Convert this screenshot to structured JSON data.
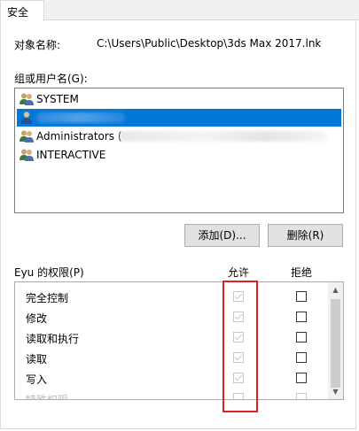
{
  "tabs": [
    {
      "label": "安全"
    }
  ],
  "object_name": {
    "label": "对象名称:",
    "value": "C:\\Users\\Public\\Desktop\\3ds Max 2017.lnk"
  },
  "groups": {
    "label": "组或用户名(G):",
    "items": [
      {
        "name": "SYSTEM",
        "selected": false
      },
      {
        "name": "",
        "selected": true
      },
      {
        "name": "Administrators (",
        "selected": false
      },
      {
        "name": "INTERACTIVE",
        "selected": false
      }
    ]
  },
  "buttons": {
    "add": "添加(D)...",
    "remove": "删除(R)"
  },
  "permissions": {
    "label": "Eyu 的权限(P)",
    "allow_header": "允许",
    "deny_header": "拒绝",
    "rows": [
      {
        "name": "完全控制",
        "allow": true,
        "deny": false
      },
      {
        "name": "修改",
        "allow": true,
        "deny": false
      },
      {
        "name": "读取和执行",
        "allow": true,
        "deny": false
      },
      {
        "name": "读取",
        "allow": true,
        "deny": false
      },
      {
        "name": "写入",
        "allow": true,
        "deny": false
      },
      {
        "name": "特殊权限",
        "allow": false,
        "deny": false
      }
    ]
  },
  "colors": {
    "selection": "#0078d7",
    "annotation": "#e02020"
  },
  "icons": {
    "user_group": "users-icon",
    "user": "user-icon"
  }
}
